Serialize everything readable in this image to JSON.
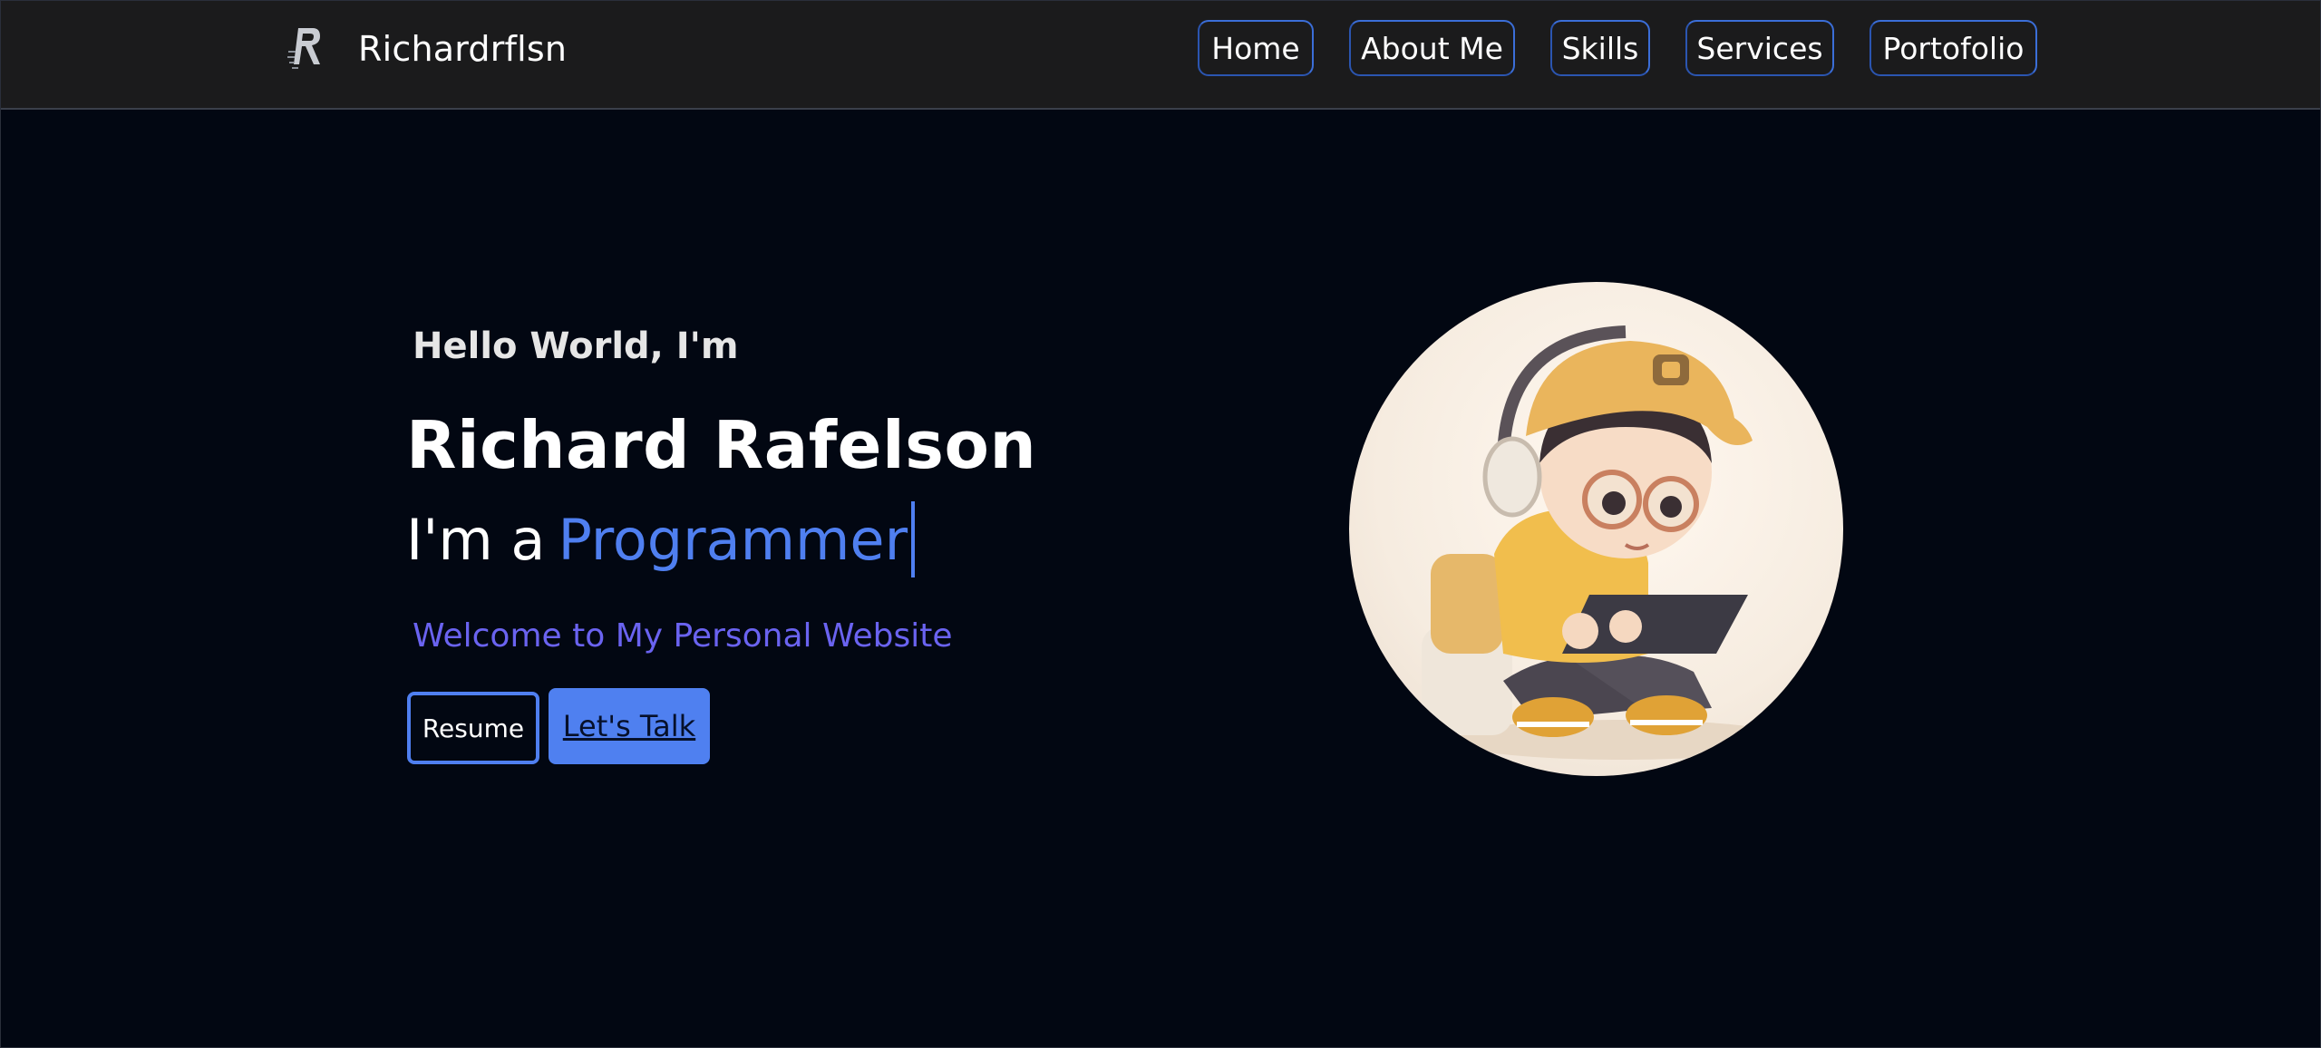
{
  "brand": {
    "name": "Richardrflsn",
    "icon": "r-logo-icon"
  },
  "nav": {
    "items": [
      {
        "label": "Home"
      },
      {
        "label": "About Me"
      },
      {
        "label": "Skills"
      },
      {
        "label": "Services"
      },
      {
        "label": "Portofolio"
      }
    ]
  },
  "hero": {
    "greeting": "Hello World, I'm",
    "name": "Richard Rafelson",
    "role_prefix": "I'm a",
    "role": "Programmer",
    "welcome": "Welcome to My Personal Website",
    "resume_label": "Resume",
    "talk_label": "Let's Talk",
    "avatar": "avatar-illustration-boy-with-headphones-and-tablet"
  },
  "colors": {
    "background": "#020712",
    "navbar": "#1b1b1c",
    "accent_blue": "#4f7ff0",
    "welcome_purple": "#6a63f0",
    "nav_border": "#3b6ed8"
  }
}
